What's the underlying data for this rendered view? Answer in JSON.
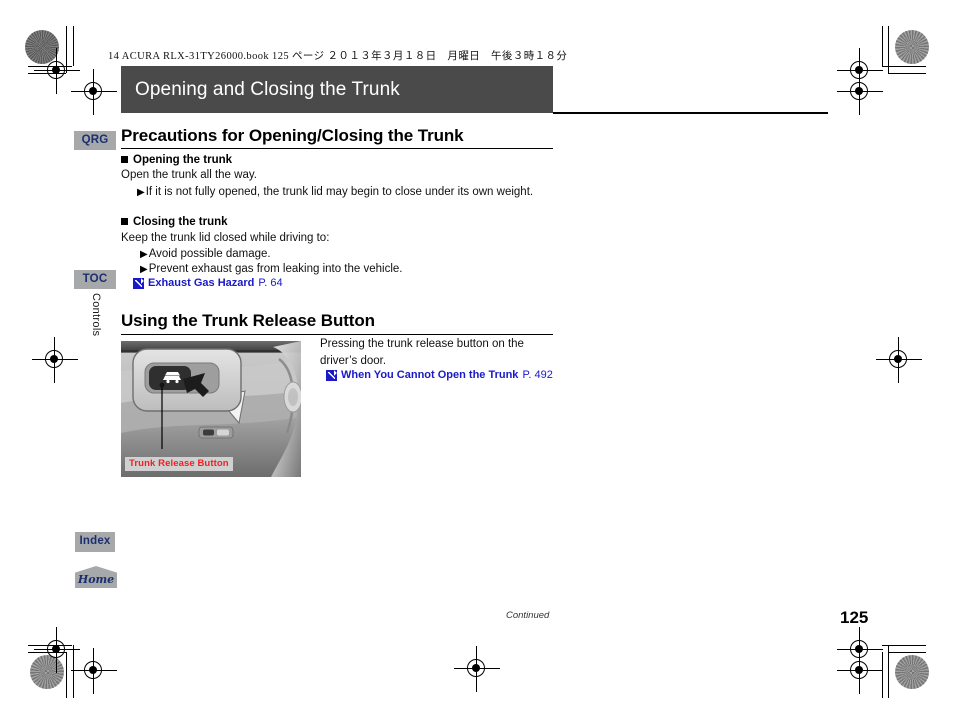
{
  "printer_header": "14 ACURA RLX-31TY26000.book  125 ページ  ２０１３年３月１８日　月曜日　午後３時１８分",
  "title_bar": {
    "title": "Opening and Closing the Trunk"
  },
  "side_tabs": {
    "qrg": "QRG",
    "toc": "TOC",
    "index": "Index",
    "home": "Home",
    "chapter": "Controls"
  },
  "sections": [
    {
      "heading": "Precautions for Opening/Closing the Trunk",
      "blocks": [
        {
          "subhead": "Opening the trunk",
          "body": "Open the trunk all the way.",
          "bullets": [
            "If it is not fully opened, the trunk lid may begin to close under its own weight."
          ]
        },
        {
          "subhead": "Closing the trunk",
          "body": "Keep the trunk lid closed while driving to:",
          "bullets": [
            "Avoid possible damage.",
            "Prevent exhaust gas from leaking into the vehicle."
          ],
          "xref": {
            "label": "Exhaust Gas Hazard",
            "page": "P. 64"
          }
        }
      ]
    },
    {
      "heading": "Using the Trunk Release Button",
      "figure": {
        "caption": "Trunk Release Button"
      },
      "right_text": [
        "Pressing the trunk release button on the",
        "driver’s door."
      ],
      "xref": {
        "label": "When You Cannot Open the Trunk",
        "page": "P. 492"
      }
    }
  ],
  "footer": {
    "continued": "Continued",
    "page_number": "125"
  },
  "colors": {
    "title_bar_bg": "#4a4a4a",
    "tab_bg": "#a6a8aa",
    "tab_text": "#1b2f6e",
    "link_blue": "#1919c8",
    "caption_red": "#f02020"
  }
}
